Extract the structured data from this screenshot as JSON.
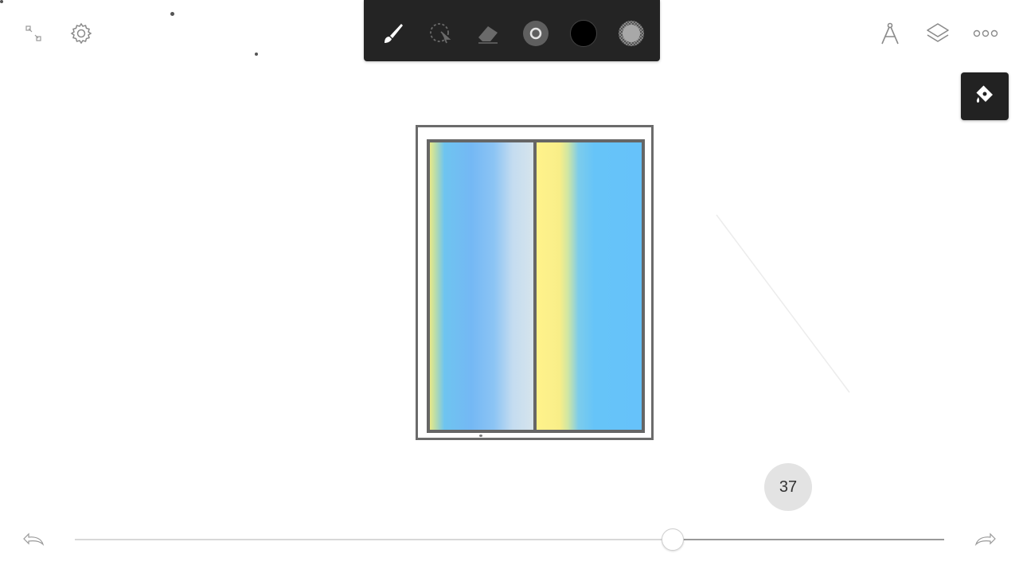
{
  "top_left": {
    "collapse_icon": "collapse-icon",
    "settings_icon": "gear-icon"
  },
  "toolbar": {
    "tools": [
      {
        "name": "brush-icon"
      },
      {
        "name": "lasso-select-icon"
      },
      {
        "name": "eraser-icon"
      },
      {
        "name": "brush-size-icon"
      },
      {
        "name": "color-swatch",
        "color": "#000000"
      },
      {
        "name": "opacity-icon"
      }
    ]
  },
  "top_right": {
    "ruler_icon": "compass-ruler-icon",
    "layers_icon": "layers-icon",
    "more_icon": "more-horizontal-icon"
  },
  "fill_tool": {
    "icon": "paint-bucket-icon"
  },
  "brush": {
    "size_value": "37",
    "slider_fraction": 0.6865
  },
  "history": {
    "undo_icon": "undo-icon",
    "redo_icon": "redo-icon"
  },
  "colors": {
    "toolbar_bg": "#242424",
    "frame": "#6b6b6b",
    "sky_blue": "#6ec4f0",
    "yellow": "#fff28a"
  }
}
